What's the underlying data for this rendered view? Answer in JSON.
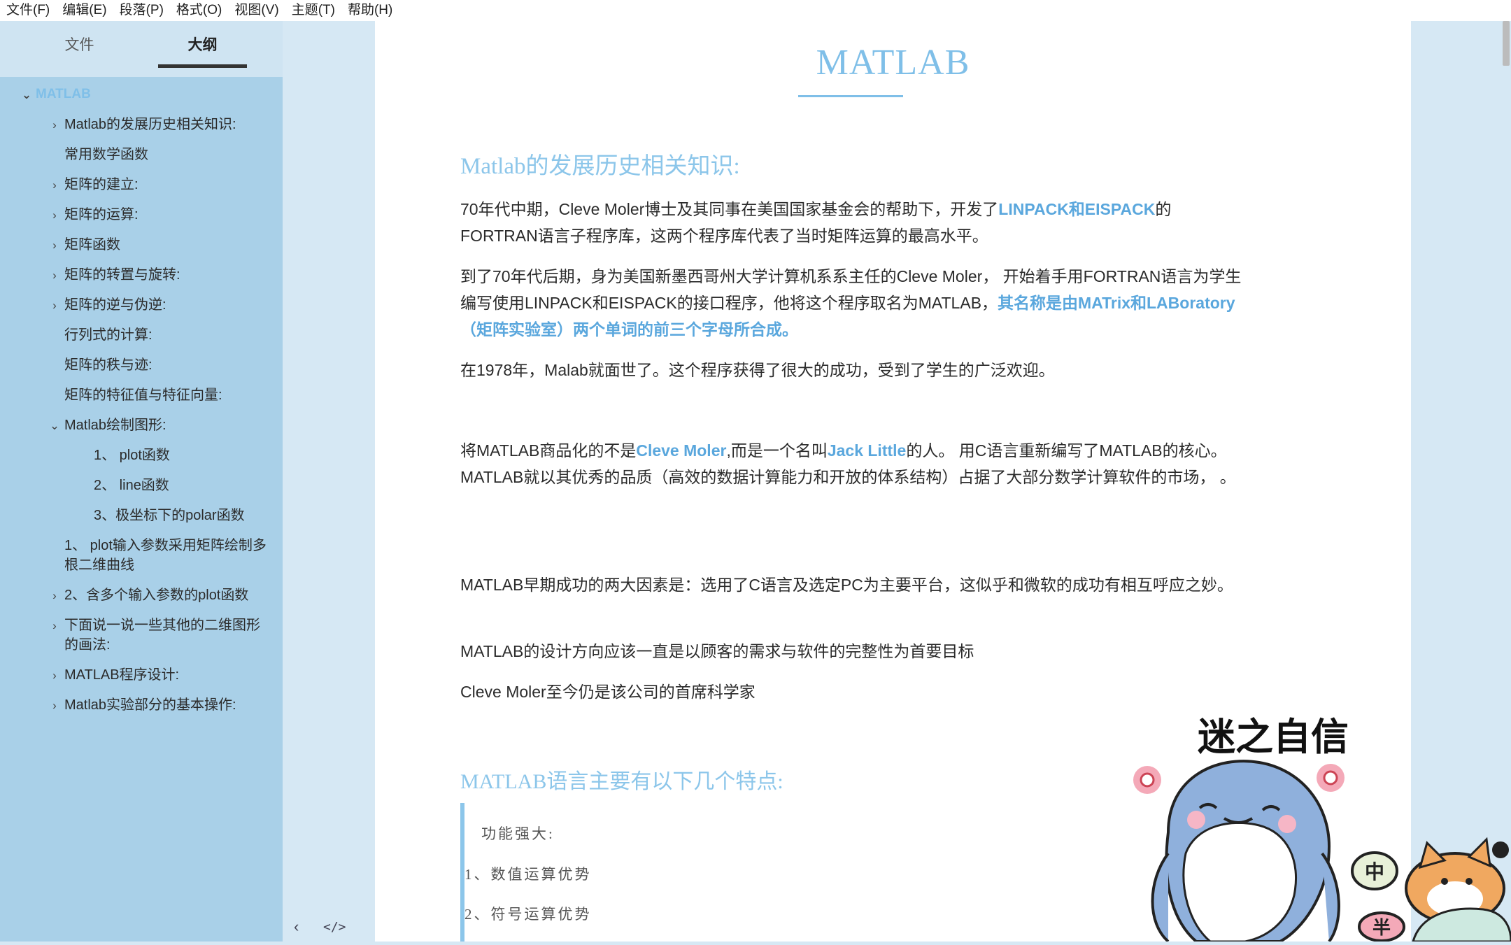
{
  "menubar": {
    "items": [
      "文件(F)",
      "编辑(E)",
      "段落(P)",
      "格式(O)",
      "视图(V)",
      "主题(T)",
      "帮助(H)"
    ]
  },
  "sidebar": {
    "tabs": {
      "files": "文件",
      "outline": "大纲"
    },
    "outline": [
      {
        "label": "MATLAB",
        "level": 0,
        "chevron": "down"
      },
      {
        "label": "Matlab的发展历史相关知识:",
        "level": 1,
        "chevron": "right"
      },
      {
        "label": "常用数学函数",
        "level": 1,
        "chevron": ""
      },
      {
        "label": "矩阵的建立:",
        "level": 1,
        "chevron": "right"
      },
      {
        "label": "矩阵的运算:",
        "level": 1,
        "chevron": "right"
      },
      {
        "label": "矩阵函数",
        "level": 1,
        "chevron": "right"
      },
      {
        "label": "矩阵的转置与旋转:",
        "level": 1,
        "chevron": "right"
      },
      {
        "label": "矩阵的逆与伪逆:",
        "level": 1,
        "chevron": "right"
      },
      {
        "label": "行列式的计算:",
        "level": 1,
        "chevron": ""
      },
      {
        "label": "矩阵的秩与迹:",
        "level": 1,
        "chevron": ""
      },
      {
        "label": "矩阵的特征值与特征向量:",
        "level": 1,
        "chevron": ""
      },
      {
        "label": "Matlab绘制图形:",
        "level": 1,
        "chevron": "down"
      },
      {
        "label": "1、 plot函数",
        "level": 3,
        "chevron": ""
      },
      {
        "label": "2、 line函数",
        "level": 3,
        "chevron": ""
      },
      {
        "label": "3、极坐标下的polar函数",
        "level": 3,
        "chevron": ""
      },
      {
        "label": "1、 plot输入参数采用矩阵绘制多根二维曲线",
        "level": 1,
        "chevron": ""
      },
      {
        "label": "2、含多个输入参数的plot函数",
        "level": 1,
        "chevron": "right"
      },
      {
        "label": "下面说一说一些其他的二维图形的画法:",
        "level": 1,
        "chevron": "right"
      },
      {
        "label": "MATLAB程序设计:",
        "level": 1,
        "chevron": "right"
      },
      {
        "label": "Matlab实验部分的基本操作:",
        "level": 1,
        "chevron": "right"
      }
    ]
  },
  "gutter": {
    "collapse_icon": "‹",
    "source_icon": "</>"
  },
  "document": {
    "title": "MATLAB",
    "h2_history": "Matlab的发展历史相关知识:",
    "p1": {
      "a": "70年代中期，Cleve Moler博士及其同事在美国国家基金会的帮助下，开发了",
      "hl": "LINPACK和EISPACK",
      "b": "的FORTRAN语言子程序库，这两个程序库代表了当时矩阵运算的最高水平。"
    },
    "p2": {
      "a": "到了70年代后期，身为美国新墨西哥州大学计算机系系主任的Cleve Moler，  开始着手用FORTRAN语言为学生编写使用LINPACK和EISPACK的接口程序，他将这个程序取名为MATLAB，",
      "hl": "其名称是由MATrix和LABoratory（矩阵实验室）两个单词的前三个字母所合成。"
    },
    "p3": "在1978年，Malab就面世了。这个程序获得了很大的成功，受到了学生的广泛欢迎。",
    "p4": {
      "a": "将MATLAB商品化的不是",
      "hl1": "Cleve Moler",
      "b": ",而是一个名叫",
      "hl2": "Jack Little",
      "c": "的人。  用C语言重新编写了MATLAB的核心。  MATLAB就以其优秀的品质（高效的数据计算能力和开放的体系结构）占据了大部分数学计算软件的市场，  。"
    },
    "p5": "MATLAB早期成功的两大因素是：选用了C语言及选定PC为主要平台，这似乎和微软的成功有相互呼应之妙。",
    "p6": "MATLAB的设计方向应该一直是以顾客的需求与软件的完整性为首要目标",
    "p7": "Cleve Moler至今仍是该公司的首席科学家",
    "h2_features": "MATLAB语言主要有以下几个特点:",
    "blockquote": [
      "功能强大:",
      "1、数值运算优势",
      "2、符号运算优势"
    ]
  },
  "sticker": {
    "caption": "迷之自信",
    "badge1": "中",
    "badge2": "半"
  }
}
